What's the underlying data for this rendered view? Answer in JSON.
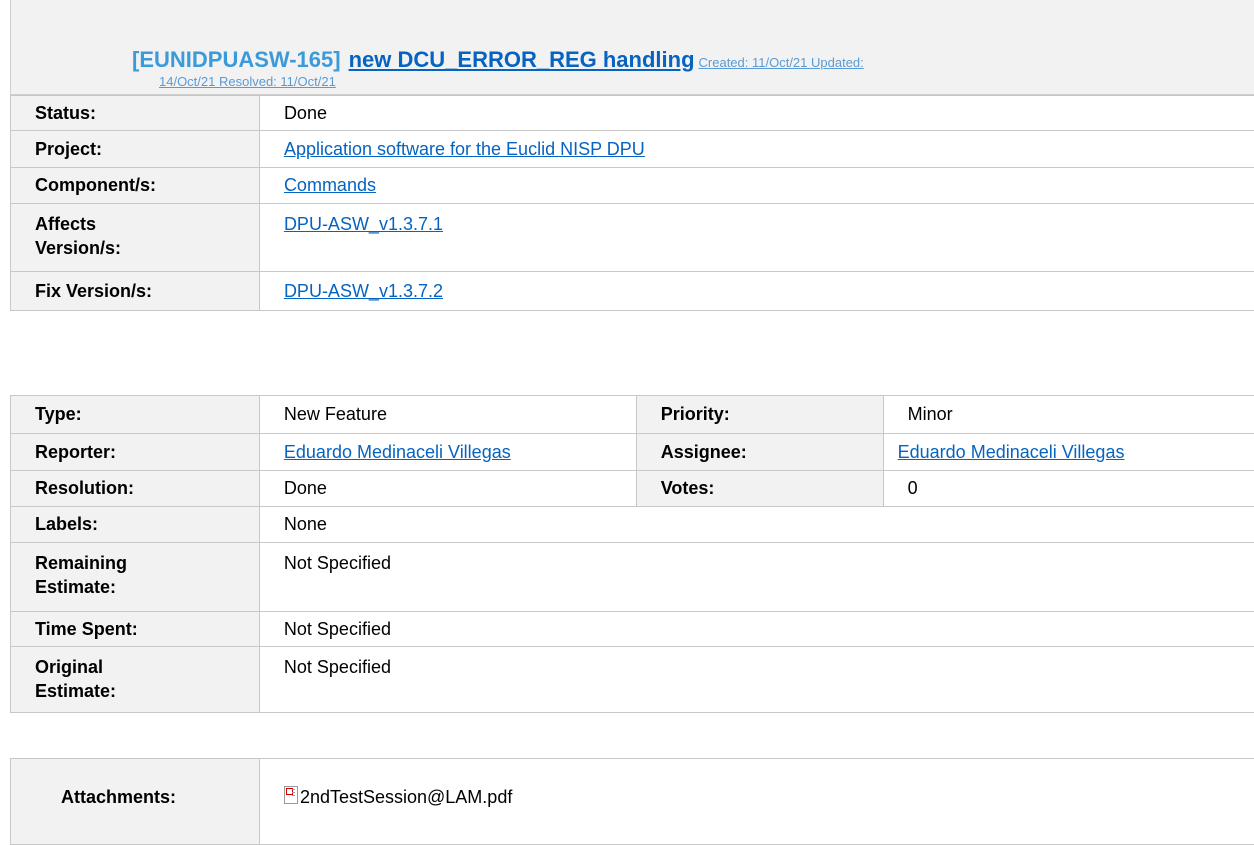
{
  "issue": {
    "key": "[EUNIDPUASW-165]",
    "title": "new DCU_ERROR_REG handling",
    "dates_line1": "Created: 11/Oct/21  Updated:",
    "dates_line2": "14/Oct/21  Resolved: 11/Oct/21"
  },
  "details": {
    "status_label": "Status:",
    "status_value": "Done",
    "project_label": "Project:",
    "project_value": "Application software for the Euclid NISP DPU",
    "component_label": "Component/s:",
    "component_value": "Commands",
    "affects_label_line1": "Affects",
    "affects_label_line2": "Version/s:",
    "affects_value": "DPU-ASW_v1.3.7.1",
    "fix_label": "Fix Version/s:",
    "fix_value": "DPU-ASW_v1.3.7.2"
  },
  "fields": {
    "type_label": "Type:",
    "type_value": "New Feature",
    "priority_label": "Priority:",
    "priority_value": "Minor",
    "reporter_label": "Reporter:",
    "reporter_value": "Eduardo Medinaceli Villegas",
    "assignee_label": "Assignee:",
    "assignee_value": "Eduardo Medinaceli Villegas",
    "resolution_label": "Resolution:",
    "resolution_value": "Done",
    "votes_label": "Votes:",
    "votes_value": "0",
    "labels_label": "Labels:",
    "labels_value": "None",
    "remaining_label_line1": "Remaining",
    "remaining_label_line2": "Estimate:",
    "remaining_value": "Not Specified",
    "timespent_label": "Time Spent:",
    "timespent_value": "Not Specified",
    "original_label_line1": "Original",
    "original_label_line2": "Estimate:",
    "original_value": "Not Specified"
  },
  "attachments": {
    "label": "Attachments:",
    "icon": "broken-image-icon",
    "file": "2ndTestSession@LAM.pdf"
  }
}
